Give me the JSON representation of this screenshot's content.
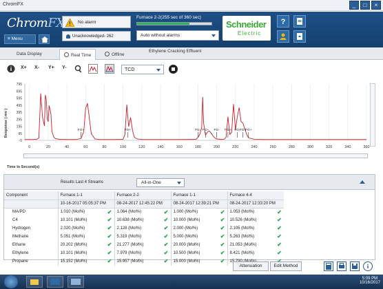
{
  "window": {
    "title": "ChromFX"
  },
  "header": {
    "logo_main": "Chrom",
    "logo_fx": "FX",
    "logo_tm": "TM",
    "menu_label": "Menu",
    "alarm_text": "No alarm",
    "unack_text": "Unacknowledged- 262",
    "furnace_status": "Furnace 2-2(255 sec of 360 sec)",
    "progress_fraction": 0.708,
    "mode_value": "Auto without alarms",
    "brand_name": "Schneider",
    "brand_sub": "Electric"
  },
  "tabs": [
    {
      "label": "Data Display"
    },
    {
      "label": "Real Time"
    },
    {
      "label": "Offline"
    }
  ],
  "tab_title": "Ethylene Cracking Effluent",
  "toolbar": {
    "info": "i",
    "x_plus": "X+",
    "x_minus": "X-",
    "y_plus": "Y+",
    "y_minus": "Y-",
    "detector": "TCD"
  },
  "chart_data": {
    "type": "line",
    "ylabel": "Response ( mv )",
    "xlabel": "Time In Second(s)",
    "xlim": [
      -5,
      360
    ],
    "ylim": [
      -5,
      795
    ],
    "x_ticks": [
      0,
      20,
      40,
      60,
      80,
      100,
      120,
      140,
      160,
      180,
      200,
      220,
      240,
      260,
      280,
      300,
      320,
      340,
      360
    ],
    "y_ticks": [
      -5,
      95,
      195,
      295,
      395,
      495,
      595,
      695,
      795
    ],
    "color": "#c81d2a",
    "series": [
      {
        "x": [
          -5,
          4,
          8,
          10,
          12,
          14,
          16,
          17,
          18,
          19,
          20,
          21,
          22,
          23,
          24,
          26,
          28,
          32,
          40,
          50,
          55,
          58,
          60,
          62,
          64,
          66,
          70,
          75,
          80,
          90,
          100,
          102,
          104,
          106,
          108,
          110,
          112,
          115,
          120,
          140,
          160,
          178,
          180,
          182,
          184,
          185,
          186,
          188,
          190,
          192,
          194,
          196,
          198,
          200,
          205,
          208,
          210,
          212,
          214,
          216,
          218,
          220,
          222,
          224,
          226,
          228,
          230,
          232,
          234,
          240,
          250,
          260,
          280,
          300,
          320,
          340,
          360
        ],
        "y": [
          8,
          8,
          12,
          30,
          660,
          320,
          200,
          640,
          560,
          300,
          260,
          490,
          430,
          360,
          120,
          40,
          18,
          10,
          8,
          8,
          20,
          120,
          450,
          520,
          300,
          90,
          15,
          8,
          8,
          8,
          10,
          80,
          500,
          190,
          320,
          140,
          40,
          15,
          8,
          8,
          8,
          10,
          40,
          80,
          180,
          610,
          240,
          70,
          110,
          130,
          100,
          60,
          30,
          15,
          10,
          12,
          40,
          330,
          80,
          110,
          510,
          140,
          330,
          460,
          260,
          240,
          160,
          80,
          30,
          12,
          8,
          8,
          8,
          8,
          8,
          8,
          8
        ]
      }
    ],
    "peak_labels": [
      {
        "x": 55,
        "text": "FG+"
      },
      {
        "x": 105,
        "text": "FG+"
      },
      {
        "x": 180,
        "text": "FG-"
      },
      {
        "x": 188,
        "text": "FG+"
      },
      {
        "x": 200,
        "text": "FG-"
      },
      {
        "x": 212,
        "text": "FG+"
      },
      {
        "x": 222,
        "text": "FG-"
      },
      {
        "x": 228,
        "text": "FG+"
      },
      {
        "x": 234,
        "text": "FG+"
      }
    ]
  },
  "results": {
    "label": "Results Last 4 Streams",
    "view_select": "All-in-One",
    "columns": [
      {
        "name": "Component",
        "date": ""
      },
      {
        "name": "Furnace 1-1",
        "date": "10-16-2017 05:05:37 PM"
      },
      {
        "name": "Furnace 2-2",
        "date": "08-24-2017 12:45:22 PM"
      },
      {
        "name": "Furnace 1-1",
        "date": "08-24-2017 12:39:21 PM"
      },
      {
        "name": "Furnace 4-4",
        "date": "08-24-2017 12:33:20 PM"
      }
    ],
    "rows": [
      {
        "component": "MA/PD",
        "values": [
          "1.010 (Mol%)",
          "1.064 (Mol%)",
          "1.000 (Mol%)",
          "1.053 (Mol%)"
        ]
      },
      {
        "component": "C4",
        "values": [
          "10.101 (Mol%)",
          "10.638 (Mol%)",
          "10.000 (Mol%)",
          "10.526 (Mol%)"
        ]
      },
      {
        "component": "Hydrogen",
        "values": [
          "2.020 (Mol%)",
          "2.128 (Mol%)",
          "2.000 (Mol%)",
          "2.105 (Mol%)"
        ]
      },
      {
        "component": "Methane",
        "values": [
          "5.051 (Mol%)",
          "5.319 (Mol%)",
          "5.000 (Mol%)",
          "5.263 (Mol%)"
        ]
      },
      {
        "component": "Ethane",
        "values": [
          "20.202 (Mol%)",
          "21.277 (Mol%)",
          "20.000 (Mol%)",
          "21.053 (Mol%)"
        ]
      },
      {
        "component": "Ethylene",
        "values": [
          "10.101 (Mol%)",
          "7.979 (Mol%)",
          "10.500 (Mol%)",
          "8.421 (Mol%)"
        ]
      },
      {
        "component": "Propane",
        "values": [
          "15.152 (Mol%)",
          "15.957 (Mol%)",
          "15.000 (Mol%)",
          "15.790 (Mol%)"
        ]
      }
    ]
  },
  "actions": {
    "attenuation": "Attenuation",
    "edit_method": "Edit Method"
  },
  "taskbar": {
    "time": "5:09 PM",
    "date": "10/16/2017"
  }
}
